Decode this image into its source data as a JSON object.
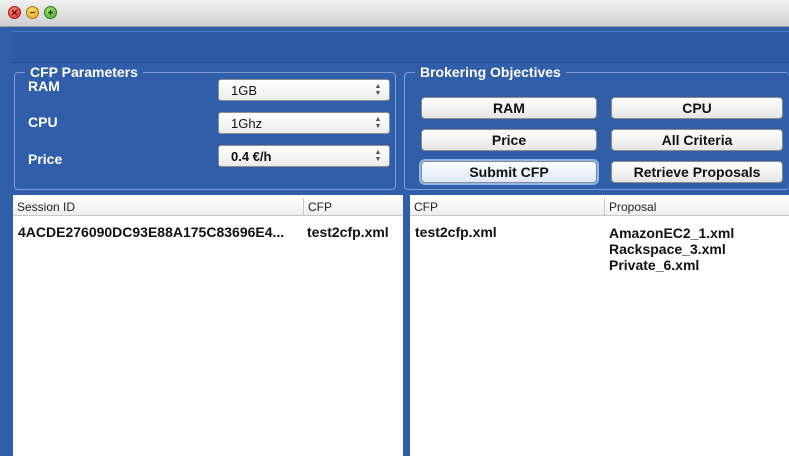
{
  "window": {
    "controls": [
      "close-icon",
      "minimize-icon",
      "maximize-icon"
    ],
    "colors": {
      "background": "#305ea8",
      "border": "#7e9dd2"
    }
  },
  "cfp_parameters": {
    "title": "CFP Parameters",
    "ram": {
      "label": "RAM",
      "value": "1GB"
    },
    "cpu": {
      "label": "CPU",
      "value": "1Ghz"
    },
    "price": {
      "label": "Price",
      "value": "0.4 €/h"
    }
  },
  "brokering_objectives": {
    "title": "Brokering Objectives",
    "ram_button": "RAM",
    "cpu_button": "CPU",
    "price_button": "Price",
    "all_criteria_button": "All Criteria",
    "submit_button": "Submit CFP",
    "retrieve_button": "Retrieve Proposals"
  },
  "sessions_table": {
    "columns": [
      "Session ID",
      "CFP"
    ],
    "rows": [
      {
        "session_id": "4ACDE276090DC93E88A175C83696E4...",
        "cfp": "test2cfp.xml"
      }
    ]
  },
  "proposals_table": {
    "columns": [
      "CFP",
      "Proposal"
    ],
    "rows": [
      {
        "cfp": "test2cfp.xml",
        "proposals": [
          "AmazonEC2_1.xml",
          "Rackspace_3.xml",
          "Private_6.xml"
        ]
      }
    ]
  }
}
